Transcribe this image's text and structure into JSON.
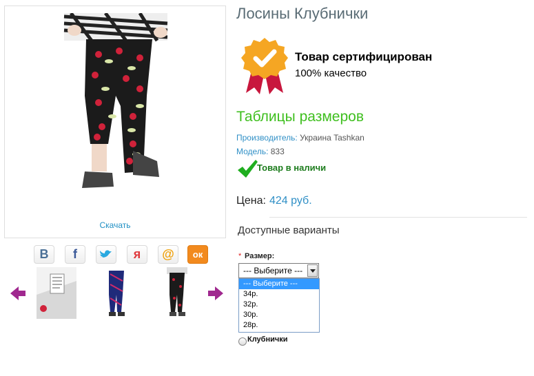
{
  "product": {
    "title": "Лосины Клубнички",
    "download_label": "Скачать"
  },
  "share": [
    {
      "icon": "vk-icon",
      "glyph": "В",
      "color": "#4a6f96"
    },
    {
      "icon": "facebook-icon",
      "glyph": "f",
      "color": "#3b5998"
    },
    {
      "icon": "twitter-icon",
      "glyph": "🐦",
      "color": "#2aa9e0"
    },
    {
      "icon": "moimir-icon",
      "glyph": "я",
      "color": "#e03a3e"
    },
    {
      "icon": "mailru-icon",
      "glyph": "@",
      "color": "#f0a10b"
    },
    {
      "icon": "odnoklassniki-icon",
      "glyph": "ок",
      "color": "#f28a1e"
    }
  ],
  "certificate": {
    "title": "Товар сертифицирован",
    "subtitle": "100% качество"
  },
  "size_table_link": "Таблицы размеров",
  "meta": {
    "manufacturer_label": "Производитель:",
    "manufacturer_value": " Украина Tashkan",
    "model_label": "Модель:",
    "model_value": " 833"
  },
  "stock_status": "Товар в наличи",
  "price": {
    "label": "Цена:",
    "value": "424 руб."
  },
  "variants": {
    "title": "Доступные варианты",
    "required_mark": "*",
    "size_label": "Размер:",
    "selected": "--- Выберите ---",
    "options": [
      "--- Выберите ---",
      "34р.",
      "32р.",
      "30р.",
      "28р."
    ],
    "radio_label": "Клубнички"
  },
  "colors": {
    "accent_green": "#3fbf1f",
    "link_blue": "#2f8fc6",
    "arrow_purple": "#a0288f"
  }
}
